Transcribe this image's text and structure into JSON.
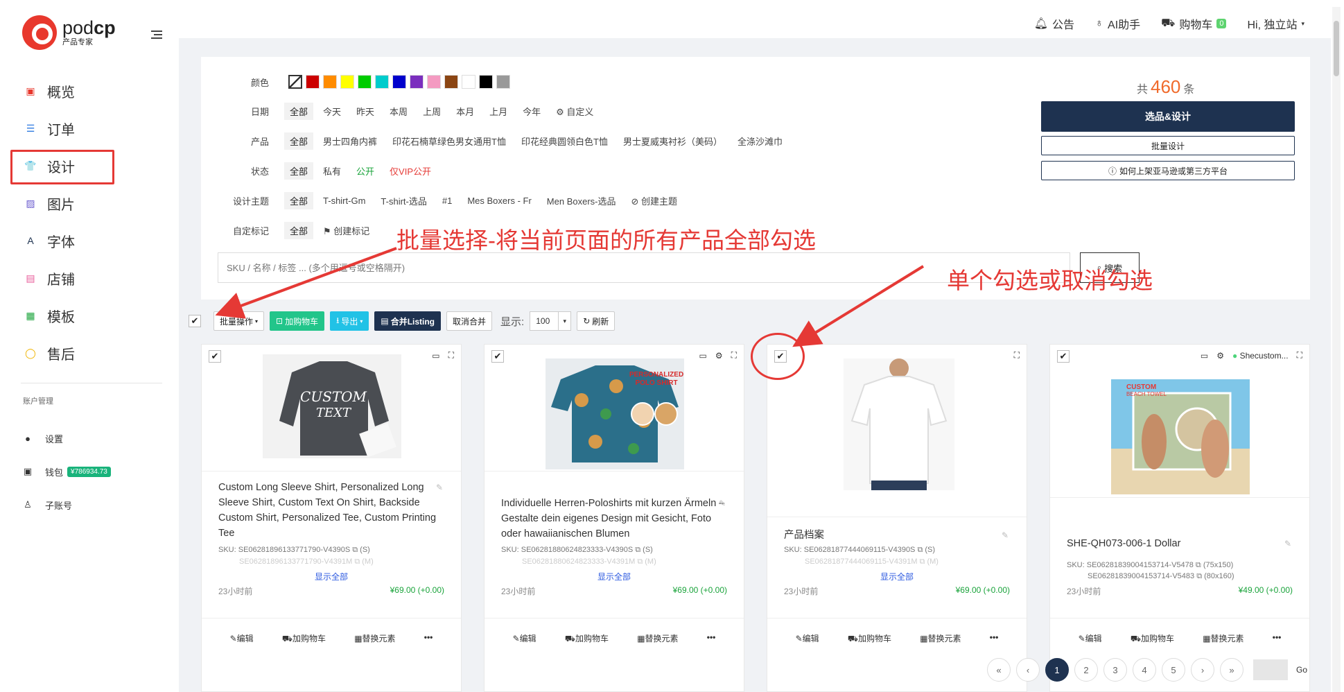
{
  "brand": {
    "name_left": "pod",
    "name_right": "cp",
    "subtitle": "产品专家"
  },
  "nav": {
    "items": [
      {
        "label": "概览",
        "icon": "monitor-icon",
        "glyph": "▣",
        "color": "#e8382d"
      },
      {
        "label": "订单",
        "icon": "list-icon",
        "glyph": "☰",
        "color": "#2d7ae0"
      },
      {
        "label": "设计",
        "icon": "shirt-icon",
        "glyph": "👕",
        "color": "#e8382d"
      },
      {
        "label": "图片",
        "icon": "image-icon",
        "glyph": "▨",
        "color": "#6b5ccf"
      },
      {
        "label": "字体",
        "icon": "font-icon",
        "glyph": "A",
        "color": "#1e3250"
      },
      {
        "label": "店铺",
        "icon": "store-icon",
        "glyph": "▤",
        "color": "#e85b9a"
      },
      {
        "label": "模板",
        "icon": "template-icon",
        "glyph": "▦",
        "color": "#19a33a"
      },
      {
        "label": "售后",
        "icon": "chat-icon",
        "glyph": "◯",
        "color": "#f0b400"
      }
    ]
  },
  "account": {
    "title": "账户管理",
    "items": [
      {
        "label": "设置",
        "icon": "user-icon",
        "glyph": "👤"
      },
      {
        "label": "钱包",
        "icon": "wallet-icon",
        "glyph": "▣"
      },
      {
        "label": "子账号",
        "icon": "subaccount-icon",
        "glyph": "👤"
      }
    ],
    "wallet_balance": "¥786934.73"
  },
  "topbar": {
    "notice": "公告",
    "ai": "AI助手",
    "cart": "购物车",
    "cart_count": "0",
    "user": "Hi, 独立站"
  },
  "filters": {
    "color_label": "颜色",
    "colors": [
      "#cc0000",
      "#ff8c00",
      "#ffff00",
      "#00cc00",
      "#00cccc",
      "#0000cc",
      "#7b2fbe",
      "#f49ac1",
      "#8b4513",
      "#ffffff",
      "#000000",
      "#999999"
    ],
    "date_label": "日期",
    "date_options": [
      "全部",
      "今天",
      "昨天",
      "本周",
      "上周",
      "本月",
      "上月",
      "今年"
    ],
    "date_custom": "自定义",
    "product_label": "产品",
    "product_options": [
      "全部",
      "男士四角内裤",
      "印花石楠草绿色男女通用T恤",
      "印花经典圆领白色T恤",
      "男士夏威夷衬衫（美码）",
      "全涤沙滩巾"
    ],
    "status_label": "状态",
    "status_options": [
      "全部",
      "私有",
      "公开",
      "仅VIP公开"
    ],
    "theme_label": "设计主题",
    "theme_options": [
      "全部",
      "T-shirt-Gm",
      "T-shirt-选品",
      "#1",
      "Mes Boxers - Fr",
      "Men Boxers-选品"
    ],
    "theme_create": "创建主题",
    "mark_label": "自定标记",
    "mark_options": [
      "全部"
    ],
    "mark_create": "创建标记",
    "search_placeholder": "SKU / 名称 / 标签 ... (多个用逗号或空格隔开)",
    "search_button": "搜索"
  },
  "summary": {
    "total_prefix": "共",
    "total": "460",
    "total_suffix": "条",
    "select_design": "选品&设计",
    "batch_design": "批量设计",
    "howto": "如何上架亚马逊或第三方平台"
  },
  "toolbar": {
    "batch_ops": "批量操作",
    "add_cart": "加购物车",
    "export": "导出",
    "merge_listing": "合并Listing",
    "unmerge": "取消合并",
    "show_label": "显示:",
    "page_size": "100",
    "refresh": "刷新"
  },
  "cards": [
    {
      "title": "Custom Long Sleeve Shirt, Personalized Long Sleeve Shirt, Custom Text On Shirt, Backside Custom Shirt, Personalized Tee, Custom Printing Tee",
      "sku1": "SKU: SE06281896133771790-V4390S ⧉ (S)",
      "sku2": "SE06281896133771790-V4391M ⧉ (M)",
      "show_all": "显示全部",
      "time": "23小时前",
      "price": "¥69.00 (+0.00)",
      "image_text": "CUSTOM TEXT"
    },
    {
      "title": "Individuelle Herren-Poloshirts mit kurzen Ärmeln – Gestalte dein eigenes Design mit Gesicht, Foto oder hawaiianischen Blumen",
      "sku1": "SKU: SE06281880624823333-V4390S ⧉ (S)",
      "sku2": "SE06281880624823333-V4391M ⧉ (M)",
      "show_all": "显示全部",
      "time": "23小时前",
      "price": "¥69.00 (+0.00)",
      "image_text": "PERSONALIZED POLO SHIRT"
    },
    {
      "title": "产品档案",
      "sku1": "SKU: SE06281877444069115-V4390S ⧉ (S)",
      "sku2": "SE06281877444069115-V4391M ⧉ (M)",
      "show_all": "显示全部",
      "time": "23小时前",
      "price": "¥69.00 (+0.00)",
      "image_text": ""
    },
    {
      "title": "SHE-QH073-006-1 Dollar",
      "sku1": "SKU: SE06281839004153714-V5478 ⧉ (75x150)",
      "sku2": "SE06281839004153714-V5483 ⧉ (80x160)",
      "show_all": "",
      "time": "23小时前",
      "price": "¥49.00 (+0.00)",
      "image_text": "CUSTOM BEACH TOWEL",
      "shop": "Shecustom..."
    }
  ],
  "card_actions": {
    "edit": "编辑",
    "cart": "加购物车",
    "replace": "替换元素",
    "more": "•••"
  },
  "pagination": {
    "pages": [
      "1",
      "2",
      "3",
      "4",
      "5"
    ],
    "current": "1",
    "first": "«",
    "prev": "‹",
    "next": "›",
    "last": "»",
    "go": "Go"
  },
  "annotations": {
    "batch_select": "批量选择-将当前页面的所有产品全部勾选",
    "single_select": "单个勾选或取消勾选"
  }
}
